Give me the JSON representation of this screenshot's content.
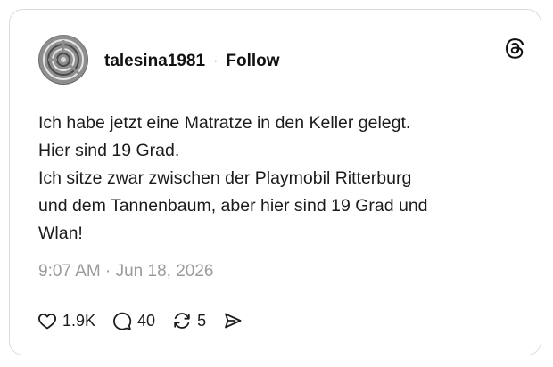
{
  "post": {
    "author": {
      "username": "talesina1981",
      "follow_label": "Follow",
      "avatar_icon": "avatar-photo"
    },
    "separator": "·",
    "brand_icon": "threads-logo-icon",
    "text_lines": [
      "Ich habe jetzt eine Matratze in den Keller gelegt.",
      "Hier sind 19 Grad.",
      "Ich sitze zwar zwischen der Playmobil Ritterburg",
      "und dem Tannenbaum, aber hier sind 19 Grad und",
      "Wlan!"
    ],
    "timestamp": "9:07 AM · Jun 18, 2026",
    "actions": {
      "likes": {
        "icon": "heart-icon",
        "count": "1.9K"
      },
      "replies": {
        "icon": "comment-icon",
        "count": "40"
      },
      "reposts": {
        "icon": "repost-icon",
        "count": "5"
      },
      "share": {
        "icon": "send-icon"
      }
    }
  },
  "colors": {
    "text": "#1c1c1c",
    "muted": "#9b9b9b",
    "border": "#dcdcdc"
  }
}
